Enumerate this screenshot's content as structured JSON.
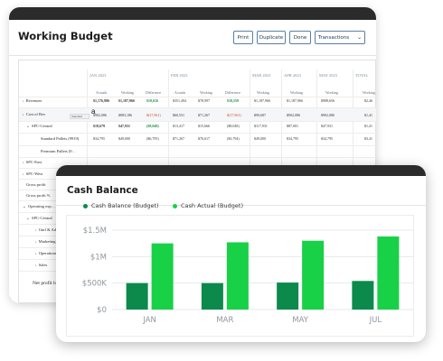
{
  "working_budget": {
    "title": "Working Budget",
    "buttons": {
      "print": "Print",
      "duplicate": "Duplicate",
      "done": "Done",
      "transactions": "Transactions"
    },
    "months": [
      "JAN 2023",
      "FEB 2023",
      "MAR 2023",
      "APR 2023",
      "MAY 2023",
      "TOTAL"
    ],
    "sub_headers": [
      "Actuals",
      "Working",
      "Difference",
      "Actuals",
      "Working",
      "Difference",
      "Working",
      "Working",
      "Working",
      "Working"
    ],
    "rows": [
      {
        "label": "Revenues",
        "values": [
          "$1,176,986",
          "$1,187,966",
          "$10,616",
          "$351,494",
          "$78,997",
          "$10,559",
          "$1,187,966",
          "$1,187,966",
          "$988,656",
          "$2,46"
        ]
      },
      {
        "label": "Cost of Rev",
        "values": [
          "$902,086",
          "$883,186",
          "$(27,961)",
          "$60,551",
          "$71,267",
          "$(17,961)",
          "$90,687",
          "$902,086",
          "$902,086",
          "$1,41"
        ]
      },
      {
        "label": "SPC-Central",
        "values": [
          "$18,679",
          "$47,931",
          "($8,048)",
          "$13,417",
          "$15,666",
          "($8,048)",
          "$117,931",
          "$87,001",
          "$47,931",
          "$1,41"
        ]
      },
      {
        "label": "Standard Pallets (9919)",
        "values": [
          "$34,795",
          "$49,000",
          "($6,795)",
          "$71,267",
          "$76,617",
          "($3,794)",
          "$49,000",
          "$34,795",
          "$34,795",
          "$3,41"
        ]
      }
    ],
    "row_labels_extra": [
      "Premium Pallets (9…",
      "SPC-East",
      "SPC-West",
      "Gross profit",
      "Gross profit %",
      "Operating exp…",
      "SPC-Central",
      "Gnrl & Adm…",
      "Marketing",
      "Operations",
      "Sales"
    ],
    "tooltip": "Standard Pallets",
    "cursor_label": "a",
    "net_label": "Net profit loss"
  },
  "cash_balance": {
    "title": "Cash Balance",
    "legend": [
      {
        "label": "Cash Balance (Budget)",
        "color": "#0b8a4b"
      },
      {
        "label": "Cash Actual (Budget)",
        "color": "#18d146"
      }
    ]
  },
  "chart_data": {
    "type": "bar",
    "title": "Cash Balance",
    "categories": [
      "JAN",
      "MAR",
      "MAY",
      "JUL"
    ],
    "series": [
      {
        "name": "Cash Balance (Budget)",
        "values": [
          500000,
          500000,
          510000,
          540000
        ],
        "color": "#0b8a4b"
      },
      {
        "name": "Cash Actual (Budget)",
        "values": [
          1250000,
          1270000,
          1300000,
          1380000
        ],
        "color": "#18d146"
      }
    ],
    "y_ticks": [
      "$0",
      "$500K",
      "$1M",
      "$1.5M"
    ],
    "y_tick_values": [
      0,
      500000,
      1000000,
      1500000
    ],
    "ylim": [
      0,
      1500000
    ],
    "grid": true,
    "legend_position": "top-left"
  }
}
